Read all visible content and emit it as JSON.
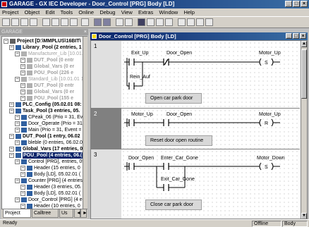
{
  "app": {
    "title": "GARAGE - GX IEC Developer - Door_Control [PRG] Body [LD]"
  },
  "menu": [
    "Project",
    "Object",
    "Edit",
    "Tools",
    "Online",
    "Debug",
    "View",
    "Extras",
    "Window",
    "Help"
  ],
  "project_panel": {
    "header": "GARAGE",
    "tree": [
      {
        "label": "Project [D:\\MMPLUS\\16BIT\\",
        "level": 0,
        "bold": true
      },
      {
        "label": "Library_Pool (2 entries, 1",
        "level": 1,
        "bold": true
      },
      {
        "label": "Manufacturer_Lib [10.01.01",
        "level": 2,
        "gray": true
      },
      {
        "label": "DUT_Pool (0 entr",
        "level": 3,
        "gray": true,
        "bold": true
      },
      {
        "label": "Global_Vars (0 er",
        "level": 3,
        "gray": true,
        "bold": true
      },
      {
        "label": "POU_Pool (226 e",
        "level": 3,
        "gray": true,
        "bold": true
      },
      {
        "label": "Standard_Lib [10.01.01 1",
        "level": 2,
        "gray": true
      },
      {
        "label": "DUT_Pool (0 entr",
        "level": 3,
        "gray": true,
        "bold": true
      },
      {
        "label": "Global_Vars (0 er",
        "level": 3,
        "gray": true,
        "bold": true
      },
      {
        "label": "POU_Pool (155 e",
        "level": 3,
        "gray": true,
        "bold": true
      },
      {
        "label": "PLC_Config (05.02.01 08:",
        "level": 1,
        "bold": true
      },
      {
        "label": "Task_Pool (3 entries, 05.",
        "level": 1,
        "bold": true
      },
      {
        "label": "CPeak_06 (Prio = 31, Ever",
        "level": 2
      },
      {
        "label": "Door_Operate (Prio = 31,",
        "level": 2
      },
      {
        "label": "Main (Prio = 31, Event = 1",
        "level": 2
      },
      {
        "label": "DUT_Pool (1 entry, 06.02",
        "level": 1,
        "bold": true
      },
      {
        "label": "bleble (0 entries, 06.02.01",
        "level": 2
      },
      {
        "label": "Global_Vars (17 entries, 0",
        "level": 1,
        "bold": true
      },
      {
        "label": "POU_Pool (4 entries, 06.(",
        "level": 1,
        "bold": true,
        "selected": true
      },
      {
        "label": "Control [PRG], entries, 05",
        "level": 2
      },
      {
        "label": "Header (15 entries, 0",
        "level": 3
      },
      {
        "label": "Body [LD], 05.02.01 (",
        "level": 3
      },
      {
        "label": "Counter [PRG] (4 entries, 05.",
        "level": 2
      },
      {
        "label": "Header (3 entries, 05.",
        "level": 3
      },
      {
        "label": "Body [LD], 05.02.01 (",
        "level": 3
      },
      {
        "label": "Door_Control [PRG] (4 entr",
        "level": 2
      },
      {
        "label": "Header (10 entries, 0",
        "level": 3
      }
    ],
    "tabs": [
      "Project",
      "Calltree",
      "Us"
    ]
  },
  "editor": {
    "title": "Door_Control [PRG] Body [LD]",
    "rungs": [
      {
        "number": "1",
        "contacts": [
          "Exit_Up",
          "Door_Open",
          "Rein_Auf"
        ],
        "coil": "Motor_Up",
        "coil_type": "S",
        "comment": "Open car park door"
      },
      {
        "number": "2",
        "contacts": [
          "Motor_Up",
          "Door_Open"
        ],
        "coil": "Motor_Up",
        "coil_type": "R",
        "comment": "Reset door open routine"
      },
      {
        "number": "3",
        "contacts": [
          "Door_Open",
          "Enter_Car_Gone",
          "Exit_Car_Gone"
        ],
        "coil": "Motor_Down",
        "coil_type": "S",
        "comment": "Close car park door"
      }
    ]
  },
  "status": {
    "left": "Ready",
    "mode": "Offline",
    "object": "Body"
  }
}
